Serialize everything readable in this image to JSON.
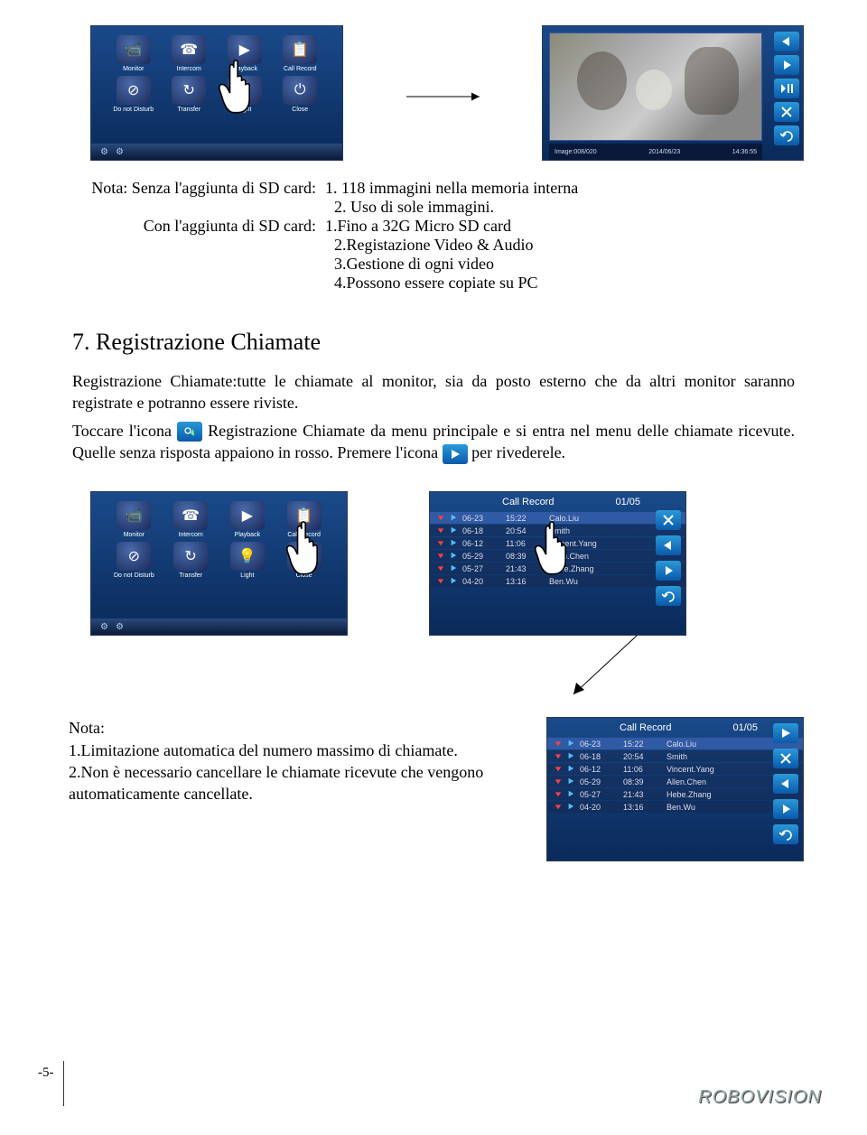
{
  "top_left_panel": {
    "icons": [
      {
        "label": "Monitor",
        "glyph": "📹"
      },
      {
        "label": "Intercom",
        "glyph": "☎"
      },
      {
        "label": "Playback",
        "glyph": "▶"
      },
      {
        "label": "Call Record",
        "glyph": "📋"
      },
      {
        "label": "Do not Disturb",
        "glyph": "⊘"
      },
      {
        "label": "Transfer",
        "glyph": "↻"
      },
      {
        "label": "Light",
        "glyph": "💡"
      },
      {
        "label": "Close",
        "glyph": "⏻"
      }
    ]
  },
  "top_right_panel": {
    "info": {
      "image": "Image:008/020",
      "date": "2014/06/23",
      "time": "14:36:55"
    }
  },
  "note1": {
    "lhs1": "Nota: Senza l'aggiunta di SD card:",
    "rhs1a": "1. 118 immagini nella memoria interna",
    "rhs1b": "2. Uso di sole immagini.",
    "lhs2": "Con l'aggiunta di SD card:",
    "rhs2a": "1.Fino a 32G Micro SD card",
    "rhs2b": "2.Registazione Video & Audio",
    "rhs2c": "3.Gestione di ogni video",
    "rhs2d": "4.Possono essere copiate su PC"
  },
  "section7": {
    "heading": "7. Registrazione Chiamate",
    "para1": "Registrazione Chiamate:tutte le chiamate al monitor, sia da posto esterno che da altri monitor saranno registrate e potranno essere riviste.",
    "para2_a": "Toccare l'icona",
    "para2_b": "Registrazione Chiamate da menu principale e si entra nel menu delle chiamate ricevute. Quelle senza risposta appaiono in rosso. Premere l'icona",
    "para2_c": "per rivederele."
  },
  "mid_left_panel": {
    "icons": [
      {
        "label": "Monitor",
        "glyph": "📹"
      },
      {
        "label": "Intercom",
        "glyph": "☎"
      },
      {
        "label": "Playback",
        "glyph": "▶"
      },
      {
        "label": "Call Record",
        "glyph": "📋"
      },
      {
        "label": "Do not Disturb",
        "glyph": "⊘"
      },
      {
        "label": "Transfer",
        "glyph": "↻"
      },
      {
        "label": "Light",
        "glyph": "💡"
      },
      {
        "label": "Close",
        "glyph": "⏻"
      }
    ]
  },
  "call_record": {
    "title": "Call Record",
    "page": "01/05",
    "rows": [
      {
        "date": "06-23",
        "time": "15:22",
        "name": "Calo.Liu"
      },
      {
        "date": "06-18",
        "time": "20:54",
        "name": "Smith"
      },
      {
        "date": "06-12",
        "time": "11:06",
        "name": "Vincent.Yang"
      },
      {
        "date": "05-29",
        "time": "08:39",
        "name": "Allen.Chen"
      },
      {
        "date": "05-27",
        "time": "21:43",
        "name": "Hebe.Zhang"
      },
      {
        "date": "04-20",
        "time": "13:16",
        "name": "Ben.Wu"
      }
    ]
  },
  "note2": {
    "heading": "Nota:",
    "l1": "1.Limitazione automatica del numero massimo di chiamate.",
    "l2": "2.Non è necessario cancellare le chiamate ricevute che vengono automaticamente cancellate."
  },
  "page_number": "-5-",
  "logo": "ROBOVISION"
}
